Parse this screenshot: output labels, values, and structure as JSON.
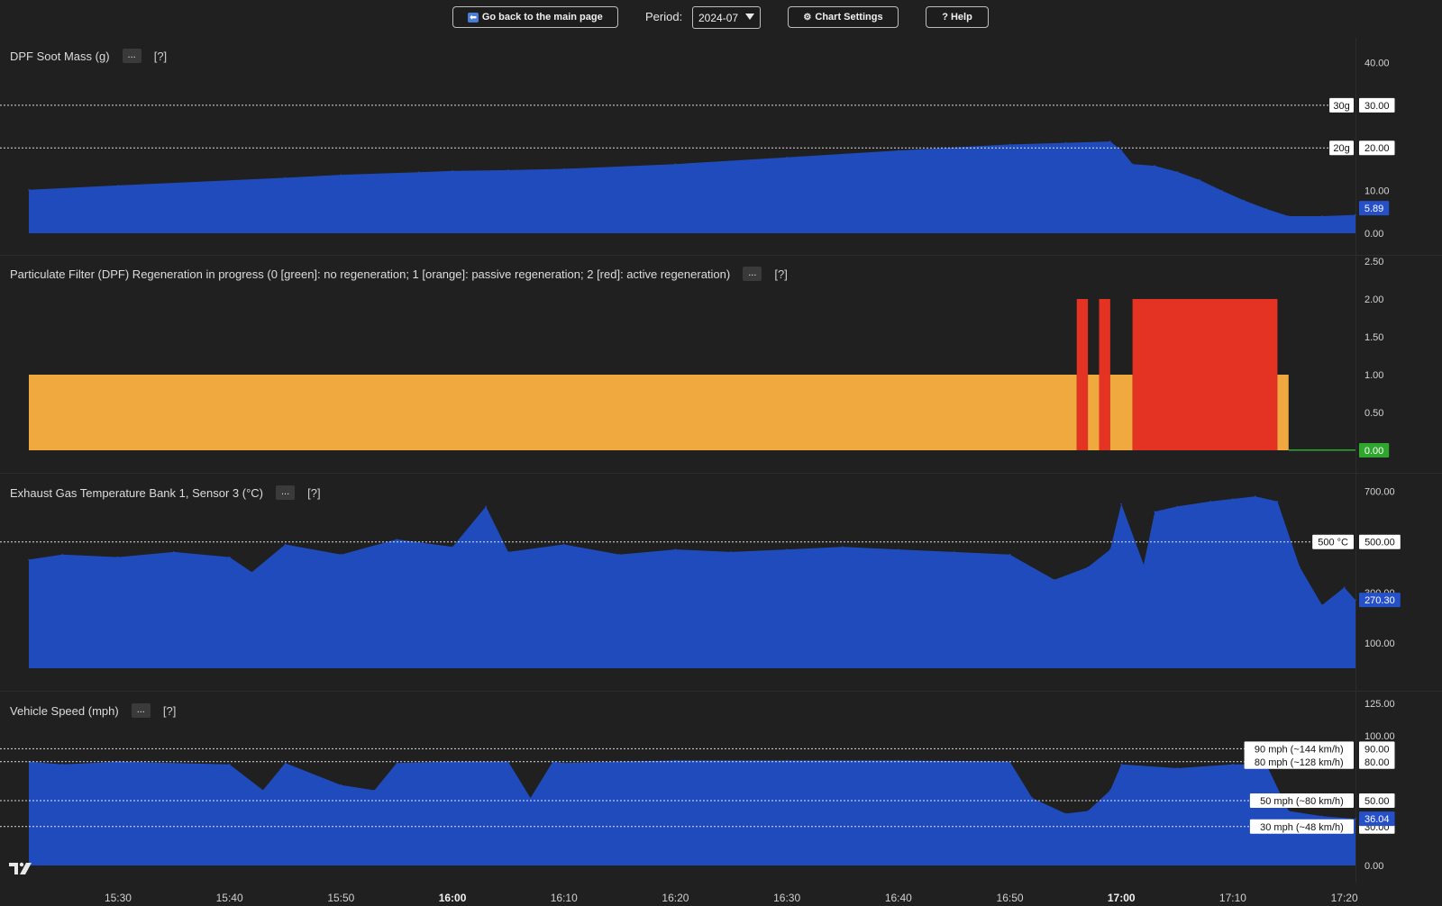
{
  "toolbar": {
    "back_label": "Go back to the main page",
    "period_label": "Period:",
    "period_value": "2024-07",
    "settings_label": "Chart Settings",
    "help_label": "? Help"
  },
  "panels": [
    {
      "title": "DPF Soot Mass (g)",
      "menu": "...",
      "help": "[?]"
    },
    {
      "title": "Particulate Filter (DPF) Regeneration in progress (0 [green]: no regeneration; 1 [orange]: passive regeneration; 2 [red]: active regeneration)",
      "menu": "...",
      "help": "[?]"
    },
    {
      "title": "Exhaust Gas Temperature Bank 1, Sensor 3 (°C)",
      "menu": "...",
      "help": "[?]"
    },
    {
      "title": "Vehicle Speed (mph)",
      "menu": "...",
      "help": "[?]"
    }
  ],
  "colors": {
    "background": "#202020",
    "series": "#1f4bbd",
    "passive": "#f0a93e",
    "active": "#e53323",
    "none": "#2fa72f",
    "grid_line": "#ffffff"
  },
  "chart_data": [
    {
      "type": "area",
      "title": "DPF Soot Mass (g)",
      "ylim": [
        0,
        42
      ],
      "y_ticks": [
        "0.00",
        "10.00",
        "20.00",
        "30.00",
        "40.00"
      ],
      "last_value": "5.89",
      "thresholds": [
        {
          "value": 30,
          "label": "30g",
          "axis_label": "30.00"
        },
        {
          "value": 20,
          "label": "20g",
          "axis_label": "20.00"
        }
      ],
      "x": [
        "15:22",
        "15:30",
        "15:45",
        "15:50",
        "15:57",
        "16:00",
        "16:05",
        "16:10",
        "16:20",
        "16:30",
        "16:40",
        "16:50",
        "16:55",
        "16:59",
        "17:00",
        "17:01",
        "17:03",
        "17:05",
        "17:07",
        "17:09",
        "17:11",
        "17:13",
        "17:15",
        "17:18",
        "17:21"
      ],
      "values": [
        10.2,
        11.2,
        13.0,
        13.7,
        14.3,
        14.6,
        14.8,
        15.1,
        16.2,
        17.8,
        19.4,
        20.8,
        21.2,
        21.5,
        19.5,
        16.2,
        15.8,
        14.4,
        12.5,
        10.0,
        7.7,
        5.7,
        4.0,
        4.0,
        4.3
      ]
    },
    {
      "type": "step",
      "title": "Particulate Filter (DPF) Regeneration in progress (0 [green]: no regeneration; 1 [orange]: passive regeneration; 2 [red]: active regeneration)",
      "ylim": [
        0,
        2.5
      ],
      "y_ticks": [
        "0.00",
        "0.50",
        "1.00",
        "1.50",
        "2.00",
        "2.50"
      ],
      "last_value": "0.00",
      "segments": [
        {
          "start": "15:22",
          "end": "16:56",
          "value": 1
        },
        {
          "start": "16:56",
          "end": "16:57",
          "value": 2
        },
        {
          "start": "16:57",
          "end": "16:58",
          "value": 1
        },
        {
          "start": "16:58",
          "end": "16:59",
          "value": 2
        },
        {
          "start": "16:59",
          "end": "17:01",
          "value": 1
        },
        {
          "start": "17:01",
          "end": "17:14",
          "value": 2
        },
        {
          "start": "17:14",
          "end": "17:15",
          "value": 1
        },
        {
          "start": "17:15",
          "end": "17:21",
          "value": 0
        }
      ]
    },
    {
      "type": "area",
      "title": "Exhaust Gas Temperature Bank 1, Sensor 3 (°C)",
      "ylim": [
        0,
        720
      ],
      "y_ticks": [
        "100.00",
        "300.00",
        "500.00",
        "700.00"
      ],
      "last_value": "270.30",
      "thresholds": [
        {
          "value": 500,
          "label": "500 °C",
          "axis_label": "500.00"
        }
      ],
      "x": [
        "15:22",
        "15:25",
        "15:30",
        "15:35",
        "15:40",
        "15:42",
        "15:45",
        "15:50",
        "15:55",
        "16:00",
        "16:03",
        "16:05",
        "16:10",
        "16:15",
        "16:20",
        "16:25",
        "16:30",
        "16:35",
        "16:40",
        "16:45",
        "16:50",
        "16:54",
        "16:57",
        "16:59",
        "17:00",
        "17:02",
        "17:03",
        "17:05",
        "17:08",
        "17:10",
        "17:12",
        "17:14",
        "17:16",
        "17:18",
        "17:20",
        "17:21"
      ],
      "values": [
        430,
        450,
        440,
        460,
        440,
        380,
        490,
        450,
        510,
        480,
        640,
        460,
        490,
        450,
        470,
        460,
        470,
        480,
        470,
        460,
        450,
        350,
        400,
        470,
        650,
        410,
        620,
        640,
        660,
        670,
        680,
        660,
        400,
        250,
        320,
        270
      ]
    },
    {
      "type": "area",
      "title": "Vehicle Speed (mph)",
      "ylim": [
        0,
        125
      ],
      "y_ticks": [
        "0.00",
        "30.00",
        "50.00",
        "80.00",
        "90.00",
        "100.00",
        "125.00"
      ],
      "last_value": "36.04",
      "thresholds": [
        {
          "value": 90,
          "label": "90 mph (~144 km/h)",
          "axis_label": "90.00"
        },
        {
          "value": 80,
          "label": "80 mph (~128 km/h)",
          "axis_label": "80.00"
        },
        {
          "value": 50,
          "label": "50 mph (~80 km/h)",
          "axis_label": "50.00"
        },
        {
          "value": 30,
          "label": "30 mph (~48 km/h)",
          "axis_label": "30.00"
        }
      ],
      "x": [
        "15:22",
        "15:25",
        "15:30",
        "15:35",
        "15:40",
        "15:43",
        "15:45",
        "15:50",
        "15:53",
        "15:55",
        "16:00",
        "16:05",
        "16:07",
        "16:09",
        "16:10",
        "16:15",
        "16:20",
        "16:30",
        "16:40",
        "16:50",
        "16:52",
        "16:55",
        "16:57",
        "16:59",
        "17:00",
        "17:05",
        "17:10",
        "17:13",
        "17:15",
        "17:18",
        "17:21"
      ],
      "values": [
        80,
        78,
        80,
        79,
        78,
        58,
        79,
        62,
        58,
        79,
        80,
        80,
        52,
        80,
        79,
        80,
        81,
        81,
        81,
        80,
        52,
        40,
        42,
        58,
        78,
        75,
        78,
        78,
        42,
        38,
        36
      ]
    }
  ],
  "x_axis": {
    "ticks": [
      {
        "label": "15:30",
        "bold": false
      },
      {
        "label": "15:40",
        "bold": false
      },
      {
        "label": "15:50",
        "bold": false
      },
      {
        "label": "16:00",
        "bold": true
      },
      {
        "label": "16:10",
        "bold": false
      },
      {
        "label": "16:20",
        "bold": false
      },
      {
        "label": "16:30",
        "bold": false
      },
      {
        "label": "16:40",
        "bold": false
      },
      {
        "label": "16:50",
        "bold": false
      },
      {
        "label": "17:00",
        "bold": true
      },
      {
        "label": "17:10",
        "bold": false
      },
      {
        "label": "17:20",
        "bold": false
      }
    ]
  }
}
